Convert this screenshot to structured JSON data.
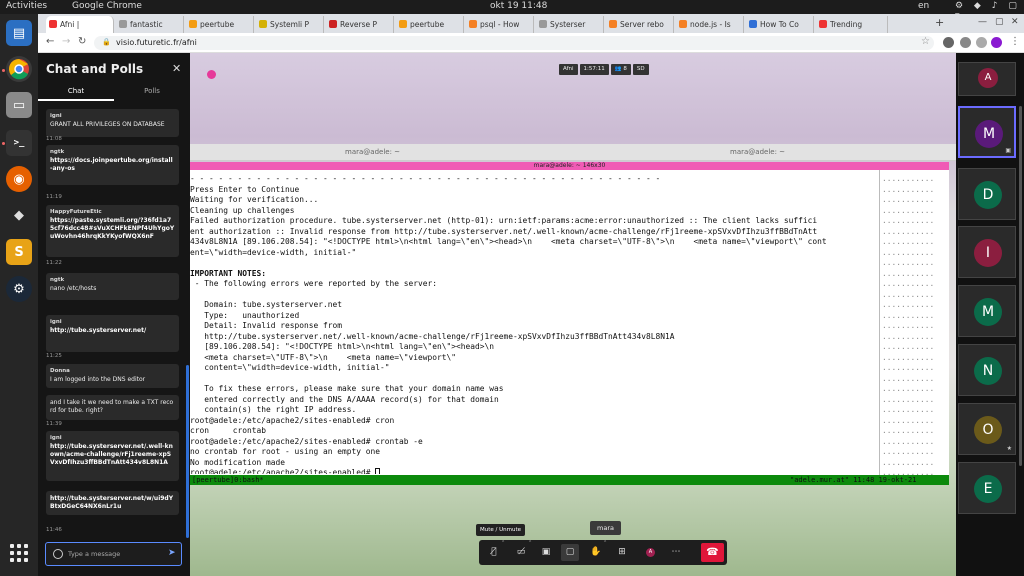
{
  "topbar": {
    "activities": "Activities",
    "app": "Google Chrome",
    "clock": "okt 19  11:48",
    "lang": "en",
    "tray": "⚙ ◆ ♪ ▢ ▾"
  },
  "browser": {
    "tabs": [
      {
        "label": "Afni |",
        "color": "#e33"
      },
      {
        "label": "fantastic",
        "color": "#999"
      },
      {
        "label": "peertube",
        "color": "#f39c12"
      },
      {
        "label": "Systemli P",
        "color": "#d4b106"
      },
      {
        "label": "Reverse P",
        "color": "#c22"
      },
      {
        "label": "peertube",
        "color": "#f39c12"
      },
      {
        "label": "psql - How",
        "color": "#f48024"
      },
      {
        "label": "Systerser",
        "color": "#999"
      },
      {
        "label": "Server rebo",
        "color": "#f48024"
      },
      {
        "label": "node.js - Is",
        "color": "#f48024"
      },
      {
        "label": "How To Co",
        "color": "#2f6fd6"
      },
      {
        "label": "Trending",
        "color": "#e33"
      }
    ],
    "new_tab": "+",
    "url": "visio.futuretic.fr/afni"
  },
  "chat": {
    "title": "Chat and Polls",
    "tab_chat": "Chat",
    "tab_polls": "Polls",
    "messages": [
      {
        "author": "igni",
        "text": "GRANT ALL PRIVILEGES ON DATABASE",
        "link": false
      },
      {
        "time": "11:08"
      },
      {
        "author": "ngtk",
        "text": "https://docs.joinpeertube.org/install-any-os",
        "link": true
      },
      {
        "time": "11:19"
      },
      {
        "author": "HappyFutureEtic",
        "text": "https://paste.systemli.org/?36fd1a75cf76dcc48#sVuXCHFkENPf4UhYgoYuWovhn46hrqKkYKyofWQX6nF",
        "link": true
      },
      {
        "time": "11:22"
      },
      {
        "author": "ngtk",
        "text": "nano /etc/hosts",
        "link": false
      },
      {
        "author": "igni",
        "text": "http://tube.systerserver.net/",
        "link": true
      },
      {
        "time": "11:25"
      },
      {
        "author": "Donna",
        "text": "I am logged into the DNS editor",
        "link": false
      },
      {
        "author": "",
        "text": "and I take it we need to make a TXT record for tube. right?",
        "link": false
      },
      {
        "time": "11:39"
      },
      {
        "author": "igni",
        "text": "http://tube.systerserver.net/.well-known/acme-challenge/rFj1reeme-xpSVxvDfIhzu3ffBBdTnAtt434v8L8N1A",
        "link": true
      },
      {
        "author": "",
        "text": "http://tube.systerserver.net/w/ui9dYBtxDGeC64NX6nLr1u",
        "link": true
      },
      {
        "time": "11:46"
      }
    ],
    "input_placeholder": "Type a message"
  },
  "meeting": {
    "room": "Afni",
    "timer": "1:57:11",
    "participants_count": "8",
    "quality": "SD",
    "tooltip": "Mute / Unmute",
    "speaker_name": "mara",
    "self_initial": "A"
  },
  "terminal": {
    "tab_left": "mara@adele: ~",
    "tab_right": "mara@adele: ~",
    "tmux_title": "mara@adele: ~ 146x30",
    "lines": [
      {
        "t": "- - - - - - - - - - - - - - - - - - - - - - - - - - - - - - - - - - - - - - - - - - - - - - - - - -",
        "b": false
      },
      {
        "t": "Press Enter to Continue",
        "b": false
      },
      {
        "t": "Waiting for verification...",
        "b": false
      },
      {
        "t": "Cleaning up challenges",
        "b": false
      },
      {
        "t": "Failed authorization procedure. tube.systerserver.net (http-01): urn:ietf:params:acme:error:unauthorized :: The client lacks suffici",
        "b": false
      },
      {
        "t": "ent authorization :: Invalid response from http://tube.systerserver.net/.well-known/acme-challenge/rFj1reeme-xpSVxvDfIhzu3ffBBdTnAtt",
        "b": false
      },
      {
        "t": "434v8L8N1A [89.106.208.54]: \"<!DOCTYPE html>\\n<html lang=\\\"en\\\"><head>\\n    <meta charset=\\\"UTF-8\\\">\\n    <meta name=\\\"viewport\\\" cont",
        "b": false
      },
      {
        "t": "ent=\\\"width=device-width, initial-\"",
        "b": false
      },
      {
        "t": "",
        "b": false
      },
      {
        "t": "IMPORTANT NOTES:",
        "b": true
      },
      {
        "t": " - The following errors were reported by the server:",
        "b": false
      },
      {
        "t": "",
        "b": false
      },
      {
        "t": "   Domain: tube.systerserver.net",
        "b": false
      },
      {
        "t": "   Type:   unauthorized",
        "b": false
      },
      {
        "t": "   Detail: Invalid response from",
        "b": false
      },
      {
        "t": "   http://tube.systerserver.net/.well-known/acme-challenge/rFj1reeme-xpSVxvDfIhzu3ffBBdTnAtt434v8L8N1A",
        "b": false
      },
      {
        "t": "   [89.106.208.54]: \"<!DOCTYPE html>\\n<html lang=\\\"en\\\"><head>\\n",
        "b": false
      },
      {
        "t": "   <meta charset=\\\"UTF-8\\\">\\n    <meta name=\\\"viewport\\\"",
        "b": false
      },
      {
        "t": "   content=\\\"width=device-width, initial-\"",
        "b": false
      },
      {
        "t": "",
        "b": false
      },
      {
        "t": "   To fix these errors, please make sure that your domain name was",
        "b": false
      },
      {
        "t": "   entered correctly and the DNS A/AAAA record(s) for that domain",
        "b": false
      },
      {
        "t": "   contain(s) the right IP address.",
        "b": false
      },
      {
        "t": "root@adele:/etc/apache2/sites-enabled# cron",
        "b": false
      },
      {
        "t": "cron     crontab",
        "b": false
      },
      {
        "t": "root@adele:/etc/apache2/sites-enabled# crontab -e",
        "b": false
      },
      {
        "t": "no crontab for root - using an empty one",
        "b": false
      },
      {
        "t": "No modification made",
        "b": false
      },
      {
        "t": "root@adele:/etc/apache2/sites-enabled# ",
        "b": false,
        "cursor": true
      }
    ],
    "right_pane_fill": "...........",
    "status_left": "[peertube]0:bash*",
    "status_right": "\"adele.mur.at\" 11:48 19-okt-21"
  },
  "participants": [
    {
      "initial": "A",
      "color": "#8b1e3f"
    },
    {
      "initial": "M",
      "color": "#5a1a7a"
    },
    {
      "initial": "D",
      "color": "#0b6b4a"
    },
    {
      "initial": "I",
      "color": "#8b1e3f"
    },
    {
      "initial": "M",
      "color": "#0b6b4a"
    },
    {
      "initial": "N",
      "color": "#0b6b4a"
    },
    {
      "initial": "O",
      "color": "#6b5a1a"
    },
    {
      "initial": "E",
      "color": "#0b6b4a"
    }
  ],
  "colors": {
    "accent": "#2f6fd6",
    "hangup": "#e0163a",
    "tmux_bar": "#f05bb5",
    "status_bar": "#0c8a0c"
  }
}
